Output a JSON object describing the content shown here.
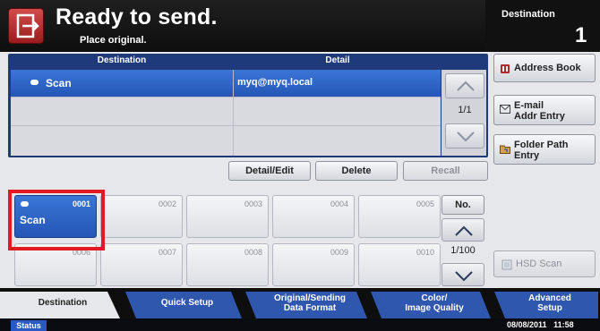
{
  "header": {
    "title": "Ready to send.",
    "subtitle": "Place original.",
    "destination_label": "Destination",
    "destination_count": "1"
  },
  "table": {
    "col_destination": "Destination",
    "col_detail": "Detail",
    "rows": [
      {
        "destination": "Scan",
        "detail": "myq@myq.local"
      }
    ],
    "page": "1/1"
  },
  "side": {
    "address_book": "Address Book",
    "email_line1": "E-mail",
    "email_line2": "Addr Entry",
    "folder_line1": "Folder Path",
    "folder_line2": "Entry",
    "hsd_scan": "HSD Scan"
  },
  "actions": {
    "detail_edit": "Detail/Edit",
    "delete": "Delete",
    "recall": "Recall"
  },
  "keys": [
    {
      "num": "0001",
      "name": "Scan"
    },
    {
      "num": "0002",
      "name": ""
    },
    {
      "num": "0003",
      "name": ""
    },
    {
      "num": "0004",
      "name": ""
    },
    {
      "num": "0005",
      "name": ""
    },
    {
      "num": "0006",
      "name": ""
    },
    {
      "num": "0007",
      "name": ""
    },
    {
      "num": "0008",
      "name": ""
    },
    {
      "num": "0009",
      "name": ""
    },
    {
      "num": "0010",
      "name": ""
    }
  ],
  "keypad": {
    "no_label": "No.",
    "page": "1/100"
  },
  "tabs": [
    {
      "line1": "Destination",
      "line2": ""
    },
    {
      "line1": "Quick Setup",
      "line2": ""
    },
    {
      "line1": "Original/Sending",
      "line2": "Data Format"
    },
    {
      "line1": "Color/",
      "line2": "Image Quality"
    },
    {
      "line1": "Advanced",
      "line2": "Setup"
    }
  ],
  "status": {
    "button": "Status",
    "date": "08/08/2011",
    "time": "11:58"
  },
  "colors": {
    "accent_blue": "#2456b6",
    "header_red": "#9a1c1c",
    "highlight_red": "#e21b23"
  }
}
